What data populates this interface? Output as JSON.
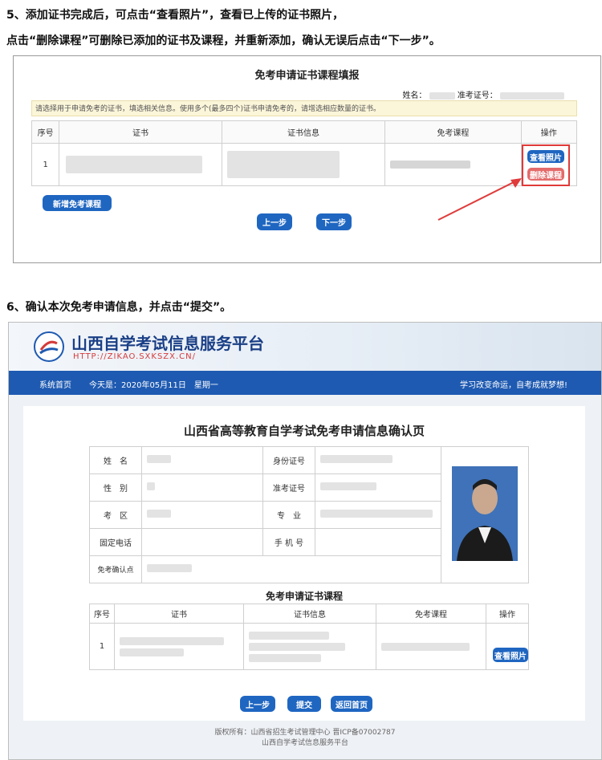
{
  "instructions": {
    "step5_line1": "5、添加证书完成后，可点击“查看照片”，查看已上传的证书照片，",
    "step5_line2": "点击“删除课程”可删除已添加的证书及课程，并重新添加，确认无误后点击“下一步”。",
    "step6": "6、确认本次免考申请信息，并点击“提交”。"
  },
  "application_form": {
    "title": "免考申请证书课程填报",
    "name_label": "姓名：",
    "ticket_label": "准考证号：",
    "notice": "请选择用于申请免考的证书，填选相关信息。使用多个(最多四个)证书申请免考的，请增选相应数量的证书。",
    "columns": [
      "序号",
      "证书",
      "证书信息",
      "免考课程",
      "操作"
    ],
    "rows": [
      {
        "index": "1"
      }
    ],
    "view_photo_label": "查看照片",
    "delete_course_label": "删除课程",
    "add_course_label": "新增免考课程",
    "prev_label": "上一步",
    "next_label": "下一步"
  },
  "platform": {
    "site_title": "山西自学考试信息服务平台",
    "site_url": "HTTP://ZIKAO.SXKSZX.CN/",
    "nav_home": "系统首页",
    "nav_date": "今天是：2020年05月11日　星期一",
    "nav_slogan": "学习改变命运，自考成就梦想!",
    "confirm_title": "山西省高等教育自学考试免考申请信息确认页",
    "labels": {
      "name": "姓　名",
      "gender": "性　别",
      "area": "考　区",
      "phone": "固定电话",
      "confirm_point": "免考确认点",
      "id_number": "身份证号",
      "ticket_number": "准考证号",
      "major": "专　业",
      "mobile": "手 机 号"
    },
    "course_title": "免考申请证书课程",
    "course_columns": [
      "序号",
      "证书",
      "证书信息",
      "免考课程",
      "操作"
    ],
    "course_rows": [
      {
        "index": "1"
      }
    ],
    "view_photo_label": "查看照片",
    "prev_label": "上一步",
    "submit_label": "提交",
    "home_label": "返回首页",
    "footer_line1": "版权所有：山西省招生考试管理中心  晋ICP备07002787",
    "footer_line2": "山西自学考试信息服务平台"
  },
  "colors": {
    "primary_button": "#1f66c1",
    "delete_button": "#e46b6b",
    "highlight_border": "#e03a3a",
    "nav_bar": "#1e5ab1",
    "notice_background": "#fbf5d9"
  },
  "icons": {
    "logo": "shanxi-exam-logo-icon",
    "arrow": "red-pointer-arrow-icon",
    "photo": "applicant-photo-icon"
  }
}
